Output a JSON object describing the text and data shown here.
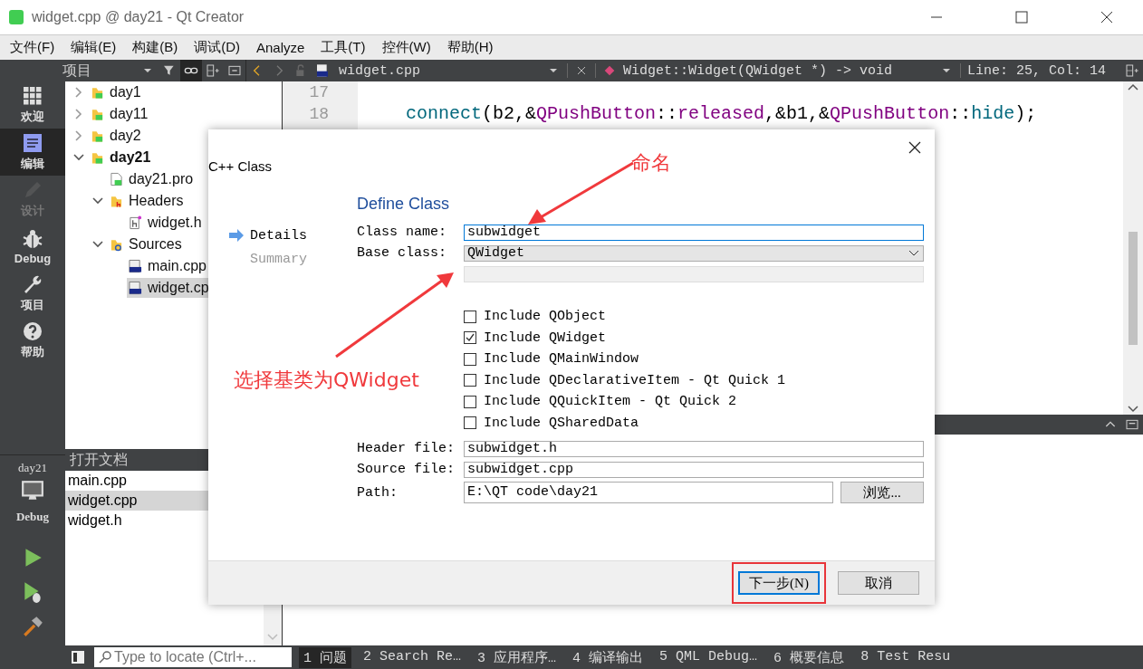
{
  "window": {
    "title": "widget.cpp @ day21 - Qt Creator"
  },
  "menu": [
    "文件(F)",
    "编辑(E)",
    "构建(B)",
    "调试(D)",
    "Analyze",
    "工具(T)",
    "控件(W)",
    "帮助(H)"
  ],
  "mode_bar": {
    "items": [
      {
        "label": "欢迎",
        "selected": false,
        "disabled": false
      },
      {
        "label": "编辑",
        "selected": true,
        "disabled": false
      },
      {
        "label": "设计",
        "selected": false,
        "disabled": true
      },
      {
        "label": "Debug",
        "selected": false,
        "disabled": false
      },
      {
        "label": "项目",
        "selected": false,
        "disabled": false
      },
      {
        "label": "帮助",
        "selected": false,
        "disabled": false
      }
    ],
    "target": {
      "project": "day21",
      "build": "Debug"
    }
  },
  "project_pane": {
    "title": "项目",
    "tree": [
      {
        "label": "day1",
        "kind": "project",
        "expanded": false,
        "active": false,
        "selected": false
      },
      {
        "label": "day11",
        "kind": "project",
        "expanded": false,
        "active": false,
        "selected": false
      },
      {
        "label": "day2",
        "kind": "project",
        "expanded": false,
        "active": false,
        "selected": false
      },
      {
        "label": "day21",
        "kind": "project",
        "expanded": true,
        "active": true,
        "selected": false,
        "children": [
          {
            "label": "day21.pro",
            "kind": "pro",
            "selected": false
          },
          {
            "label": "Headers",
            "kind": "header-folder",
            "expanded": true,
            "selected": false,
            "children": [
              {
                "label": "widget.h",
                "kind": "header",
                "selected": false
              }
            ]
          },
          {
            "label": "Sources",
            "kind": "source-folder",
            "expanded": true,
            "selected": false,
            "children": [
              {
                "label": "main.cpp",
                "kind": "source",
                "selected": false
              },
              {
                "label": "widget.cp",
                "kind": "source",
                "selected": true
              }
            ]
          }
        ]
      }
    ]
  },
  "open_documents": {
    "title": "打开文档",
    "items": [
      {
        "label": "main.cpp",
        "selected": false
      },
      {
        "label": "widget.cpp",
        "selected": true
      },
      {
        "label": "widget.h",
        "selected": false
      }
    ]
  },
  "editor": {
    "file": "widget.cpp",
    "function": "Widget::Widget(QWidget *) -> void",
    "position": "Line: 25, Col: 14",
    "lines": [
      {
        "number": "17"
      },
      {
        "number": "18",
        "tokens": [
          {
            "text": "connect",
            "kind": "function"
          },
          {
            "text": "(b2,&",
            "kind": "plain"
          },
          {
            "text": "QPushButton",
            "kind": "type"
          },
          {
            "text": "::",
            "kind": "plain"
          },
          {
            "text": "released",
            "kind": "member"
          },
          {
            "text": ",&b1,&",
            "kind": "plain"
          },
          {
            "text": "QPushButton",
            "kind": "type"
          },
          {
            "text": "::",
            "kind": "plain"
          },
          {
            "text": "hide",
            "kind": "function"
          },
          {
            "text": ");",
            "kind": "plain"
          }
        ]
      }
    ]
  },
  "dialog": {
    "title": "C++ Class",
    "steps": [
      {
        "label": "Details",
        "selected": true
      },
      {
        "label": "Summary",
        "selected": false
      }
    ],
    "heading": "Define Class",
    "fields": [
      {
        "label": "Class name:",
        "kind": "text",
        "value": "subwidget",
        "focused": true
      },
      {
        "label": "Base class:",
        "kind": "combo",
        "value": "QWidget",
        "focused": false
      },
      {
        "kind": "blank",
        "focused": false
      }
    ],
    "options": [
      {
        "label": "Include QObject",
        "checked": false
      },
      {
        "label": "Include QWidget",
        "checked": true
      },
      {
        "label": "Include QMainWindow",
        "checked": false
      },
      {
        "label": "Include QDeclarativeItem - Qt Quick 1",
        "checked": false
      },
      {
        "label": "Include QQuickItem - Qt Quick 2",
        "checked": false
      },
      {
        "label": "Include QSharedData",
        "checked": false
      }
    ],
    "files": [
      {
        "label": "Header file:",
        "value": "subwidget.h"
      },
      {
        "label": "Source file:",
        "value": "subwidget.cpp"
      }
    ],
    "path": {
      "label": "Path:",
      "value": "E:\\QT code\\day21",
      "browse": "浏览..."
    },
    "buttons": [
      {
        "label": "下一步(N)",
        "default": true,
        "highlighted": true
      },
      {
        "label": "取消",
        "default": false,
        "highlighted": false
      }
    ],
    "annotations": [
      {
        "text": "命名"
      },
      {
        "text": "选择基类为QWidget"
      }
    ]
  },
  "status_bar": {
    "locator": {
      "placeholder": "Type to locate (Ctrl+..."
    },
    "tabs": [
      {
        "label": "1 问题",
        "selected": true
      },
      {
        "label": "2 Search Re…",
        "selected": false
      },
      {
        "label": "3 应用程序…",
        "selected": false
      },
      {
        "label": "4 编译输出",
        "selected": false
      },
      {
        "label": "5 QML Debug…",
        "selected": false
      },
      {
        "label": "6 概要信息",
        "selected": false
      },
      {
        "label": "8 Test Resu",
        "selected": false
      }
    ]
  }
}
